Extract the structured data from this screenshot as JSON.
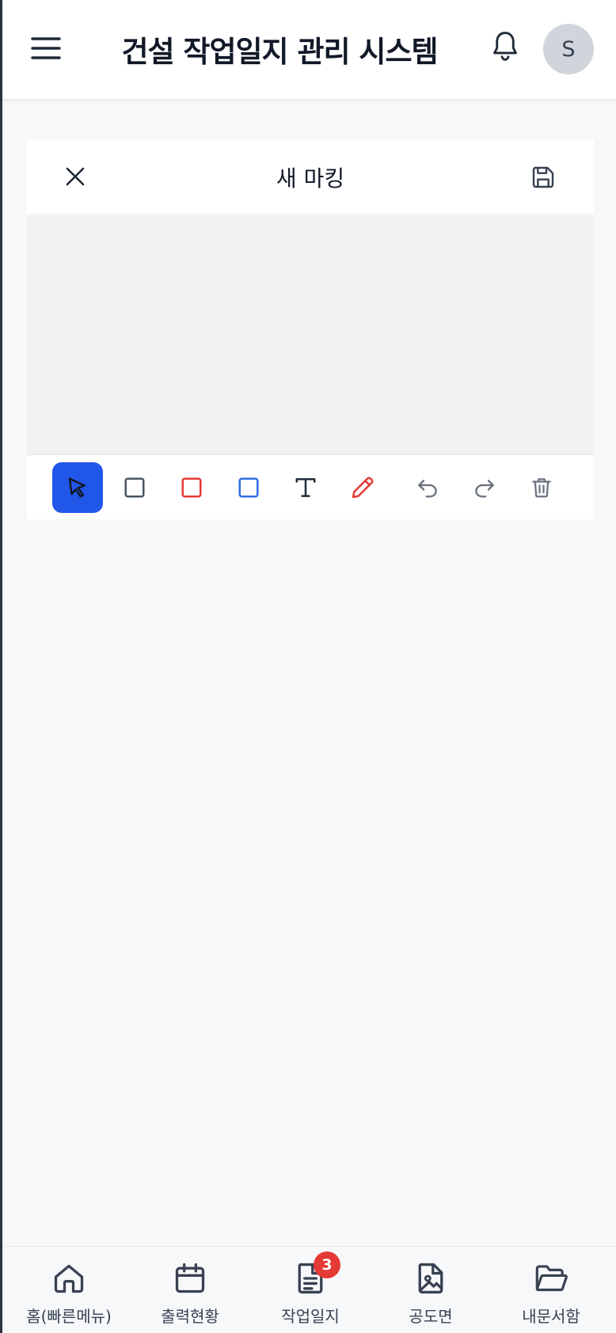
{
  "header": {
    "title": "건설 작업일지 관리 시스템",
    "avatar_initial": "S",
    "icons": {
      "menu": "hamburger-icon",
      "notification": "bell-icon"
    }
  },
  "editor": {
    "title": "새 마킹",
    "icons": {
      "close": "close-icon",
      "save": "floppy-disk-icon"
    },
    "tools": [
      {
        "id": "select",
        "icon": "cursor-arrow-icon",
        "active": true
      },
      {
        "id": "rect",
        "icon": "square-icon",
        "color": "#4b5563"
      },
      {
        "id": "rect-red",
        "icon": "square-icon",
        "color": "#e53935"
      },
      {
        "id": "rect-blue",
        "icon": "square-icon",
        "color": "#2f6fe8"
      },
      {
        "id": "text",
        "icon": "text-icon"
      },
      {
        "id": "pen",
        "icon": "pencil-icon",
        "color": "#e53935"
      },
      {
        "id": "undo",
        "icon": "undo-icon"
      },
      {
        "id": "redo",
        "icon": "redo-icon"
      },
      {
        "id": "delete",
        "icon": "trash-icon"
      }
    ]
  },
  "colors": {
    "accent": "#2157e8",
    "red": "#e53935",
    "blue": "#2f6fe8",
    "badge": "#e53935"
  },
  "bottom_nav": {
    "items": [
      {
        "label": "홈(빠른메뉴)",
        "icon": "home-icon"
      },
      {
        "label": "출력현황",
        "icon": "calendar-icon"
      },
      {
        "label": "작업일지",
        "icon": "document-icon",
        "badge": "3"
      },
      {
        "label": "공도면",
        "icon": "image-file-icon"
      },
      {
        "label": "내문서함",
        "icon": "folder-open-icon"
      }
    ]
  }
}
